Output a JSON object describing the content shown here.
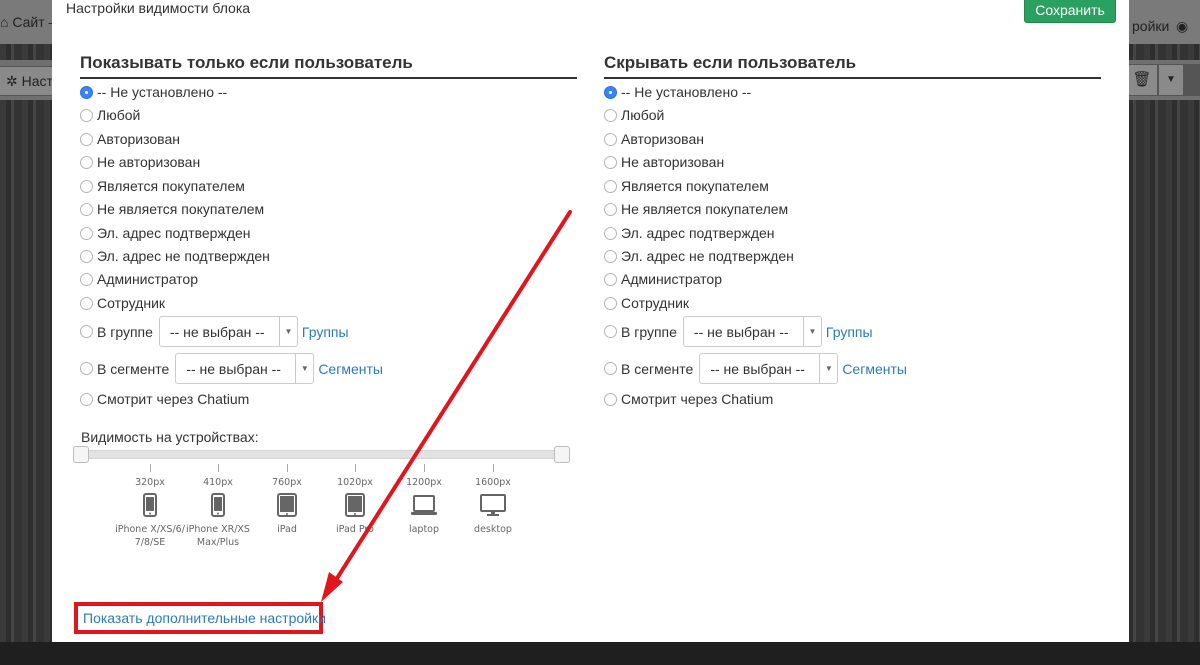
{
  "background": {
    "site_label": "Сайт —",
    "settings_label": "ройки",
    "toolbar_label": "Наст"
  },
  "modal": {
    "title": "Настройки видимости блока",
    "save_label": "Сохранить",
    "left_column": {
      "title": "Показывать только если пользователь",
      "options": [
        "-- Не установлено --",
        "Любой",
        "Авторизован",
        "Не авторизован",
        "Является покупателем",
        "Не является покупателем",
        "Эл. адрес подтвержден",
        "Эл. адрес не подтвержден",
        "Администратор",
        "Сотрудник"
      ],
      "group_label": "В группе",
      "group_select": "-- не выбран --",
      "group_link": "Группы",
      "segment_label": "В сегменте",
      "segment_select": "-- не выбран --",
      "segment_link": "Сегменты",
      "chatium_label": "Смотрит через Chatium",
      "selected": "-- Не установлено --"
    },
    "right_column": {
      "title": "Скрывать если пользователь",
      "options": [
        "-- Не установлено --",
        "Любой",
        "Авторизован",
        "Не авторизован",
        "Является покупателем",
        "Не является покупателем",
        "Эл. адрес подтвержден",
        "Эл. адрес не подтвержден",
        "Администратор",
        "Сотрудник"
      ],
      "group_label": "В группе",
      "group_select": "-- не выбран --",
      "group_link": "Группы",
      "segment_label": "В сегменте",
      "segment_select": "-- не выбран --",
      "segment_link": "Сегменты",
      "chatium_label": "Смотрит через Chatium",
      "selected": "-- Не установлено --"
    },
    "devices": {
      "label": "Видимость на устройствах:",
      "items": [
        {
          "px": "320px",
          "icon": "phone-icon",
          "name": "iPhone X/XS/6/ 7/8/SE"
        },
        {
          "px": "410px",
          "icon": "phone-icon",
          "name": "iPhone XR/XS Max/Plus"
        },
        {
          "px": "760px",
          "icon": "tablet-icon",
          "name": "iPad"
        },
        {
          "px": "1020px",
          "icon": "tablet-icon",
          "name": "iPad Pro"
        },
        {
          "px": "1200px",
          "icon": "laptop-icon",
          "name": "laptop"
        },
        {
          "px": "1600px",
          "icon": "desktop-icon",
          "name": "desktop"
        }
      ],
      "range": [
        0,
        1
      ]
    },
    "more_settings_link": "Показать дополнительные настройки"
  },
  "annotation": {
    "color": "#e0161c"
  }
}
